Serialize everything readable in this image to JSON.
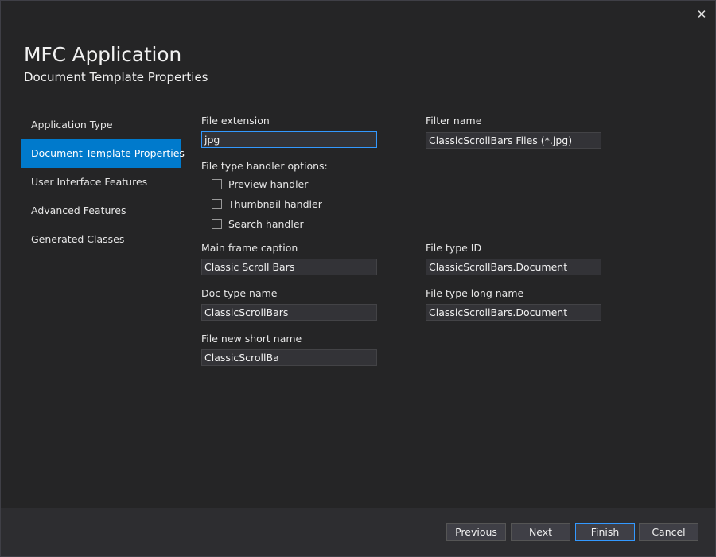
{
  "window": {
    "title": "MFC Application",
    "subtitle": "Document Template Properties",
    "close_glyph": "✕"
  },
  "sidebar": {
    "items": [
      {
        "label": "Application Type"
      },
      {
        "label": "Document Template Properties",
        "active": true
      },
      {
        "label": "User Interface Features"
      },
      {
        "label": "Advanced Features"
      },
      {
        "label": "Generated Classes"
      }
    ]
  },
  "form": {
    "file_extension": {
      "label": "File extension",
      "value": "jpg"
    },
    "filter_name": {
      "label": "Filter name",
      "value": "ClassicScrollBars Files (*.jpg)"
    },
    "handler_options": {
      "label": "File type handler options:",
      "options": [
        {
          "label": "Preview handler",
          "checked": false
        },
        {
          "label": "Thumbnail handler",
          "checked": false
        },
        {
          "label": "Search handler",
          "checked": false
        }
      ]
    },
    "main_frame_caption": {
      "label": "Main frame caption",
      "value": "Classic Scroll Bars"
    },
    "file_type_id": {
      "label": "File type ID",
      "value": "ClassicScrollBars.Document"
    },
    "doc_type_name": {
      "label": "Doc type name",
      "value": "ClassicScrollBars"
    },
    "file_type_long_name": {
      "label": "File type long name",
      "value": "ClassicScrollBars.Document"
    },
    "file_new_short_name": {
      "label": "File new short name",
      "value": "ClassicScrollBa"
    }
  },
  "footer": {
    "previous": "Previous",
    "next": "Next",
    "finish": "Finish",
    "cancel": "Cancel"
  },
  "colors": {
    "background": "#252526",
    "accent": "#007acc",
    "field_bg": "#333337",
    "focus_border": "#3399ff"
  }
}
